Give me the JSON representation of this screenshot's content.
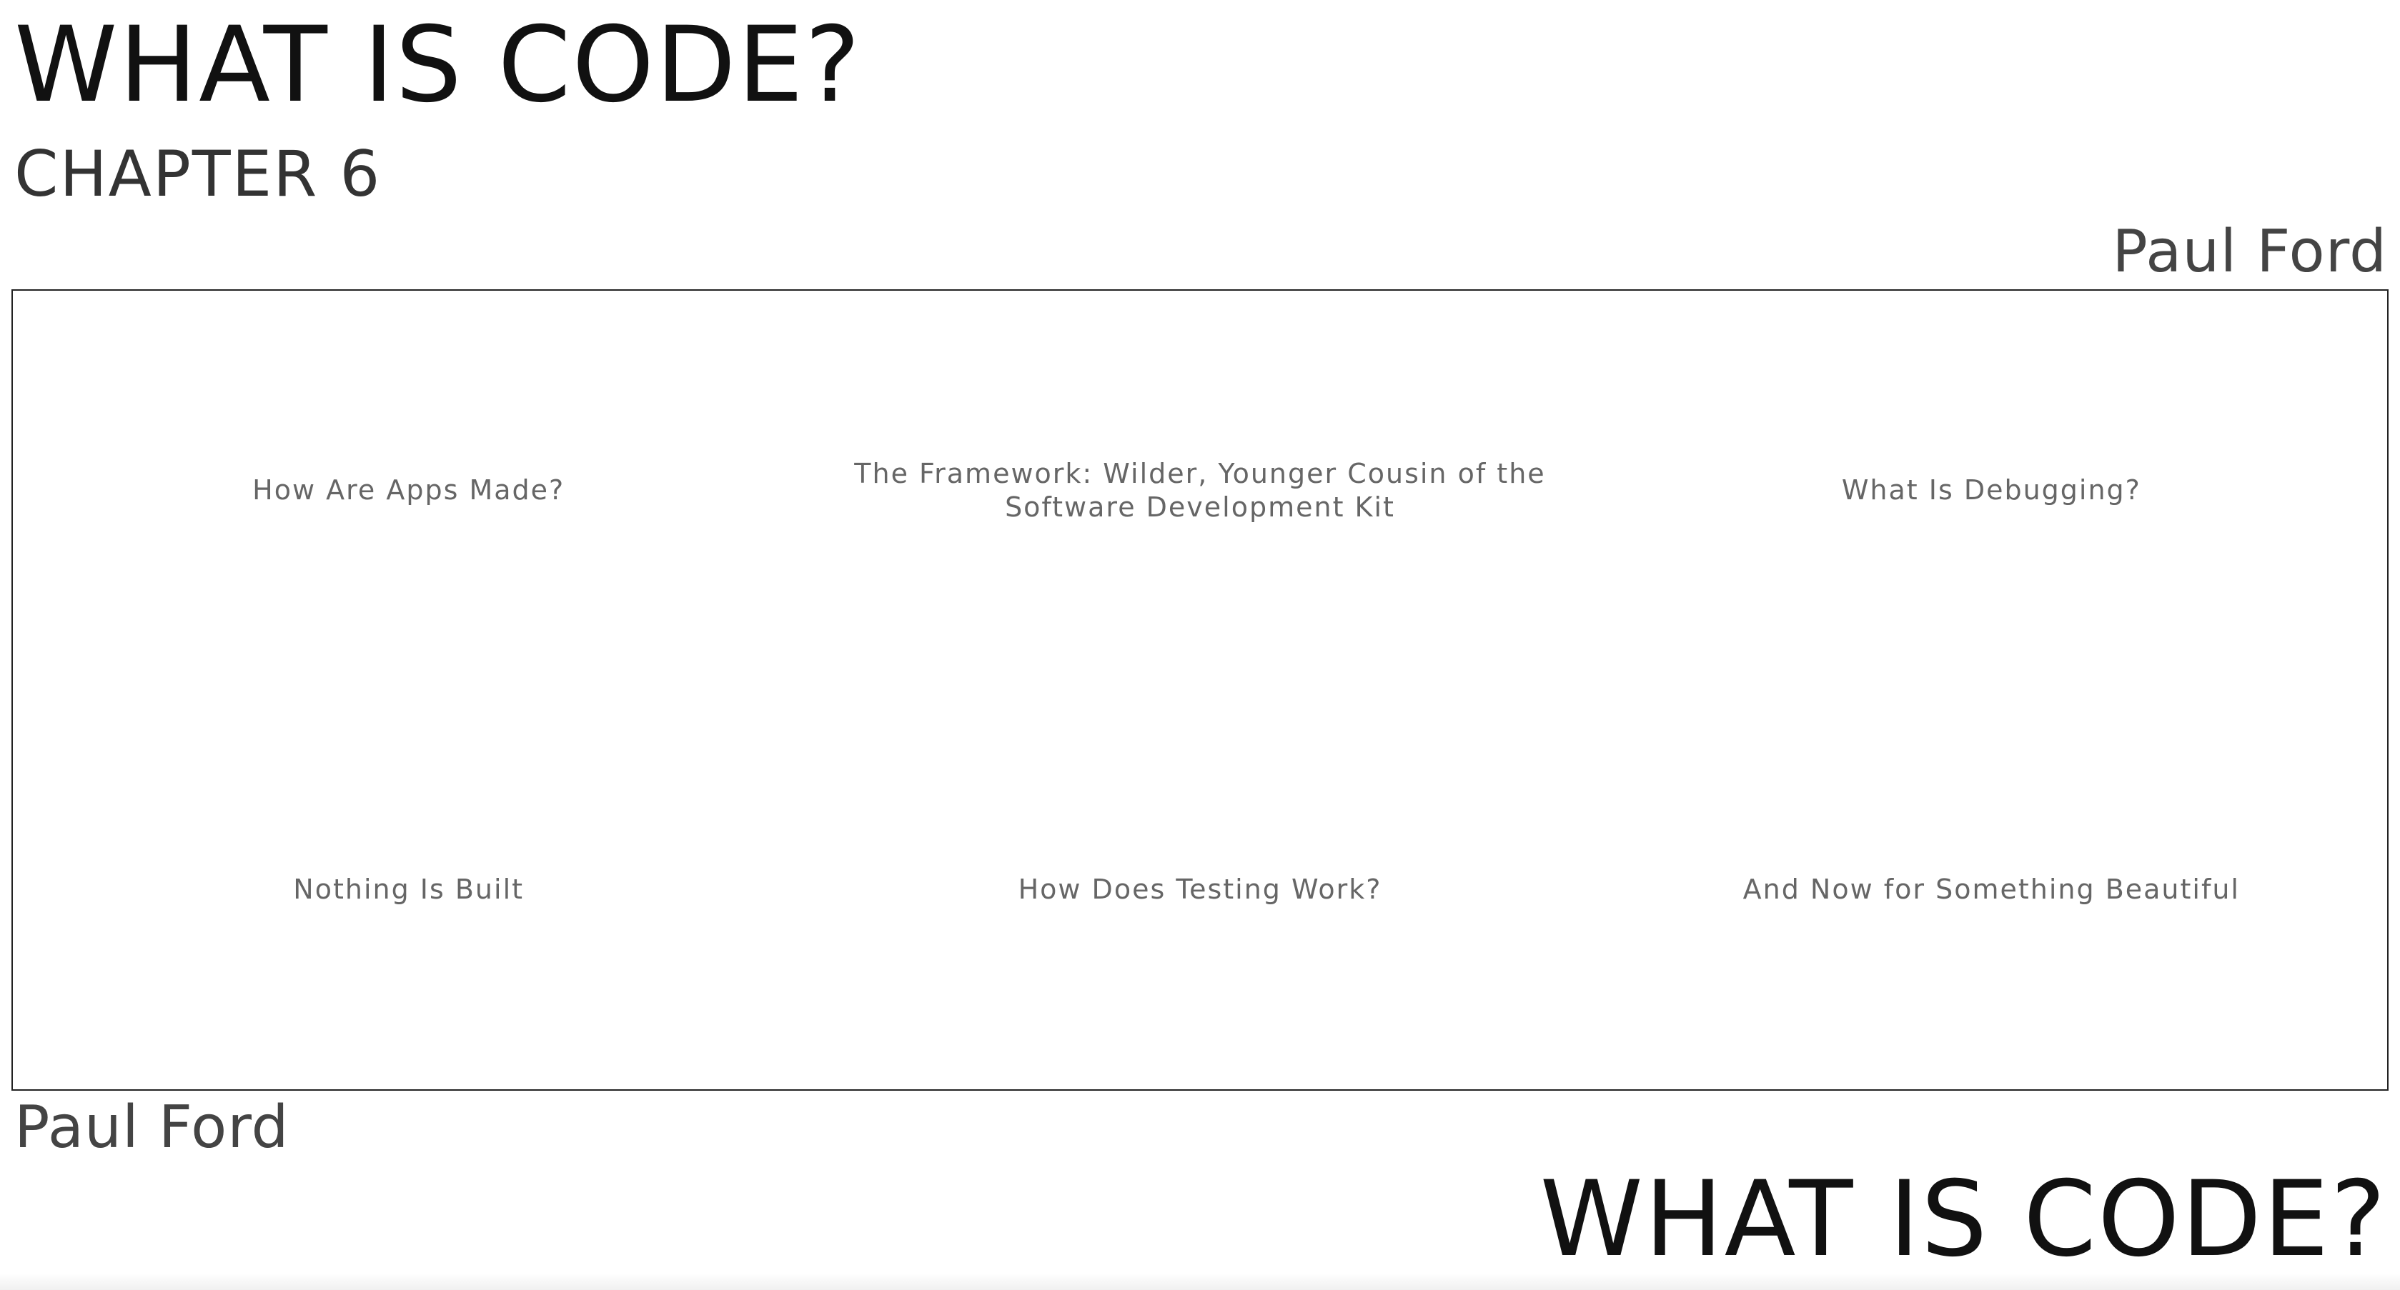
{
  "header": {
    "title": "WHAT IS CODE?",
    "chapter": "CHAPTER 6",
    "author": "Paul Ford"
  },
  "toc": {
    "items": [
      {
        "label": "How Are Apps Made?"
      },
      {
        "label": "The Framework: Wilder, Younger Cousin of the Software Development Kit"
      },
      {
        "label": "What Is Debugging?"
      },
      {
        "label": "Nothing Is Built"
      },
      {
        "label": "How Does Testing Work?"
      },
      {
        "label": "And Now for Something Beautiful"
      }
    ]
  },
  "footer": {
    "author": "Paul Ford",
    "title": "WHAT IS CODE?"
  }
}
